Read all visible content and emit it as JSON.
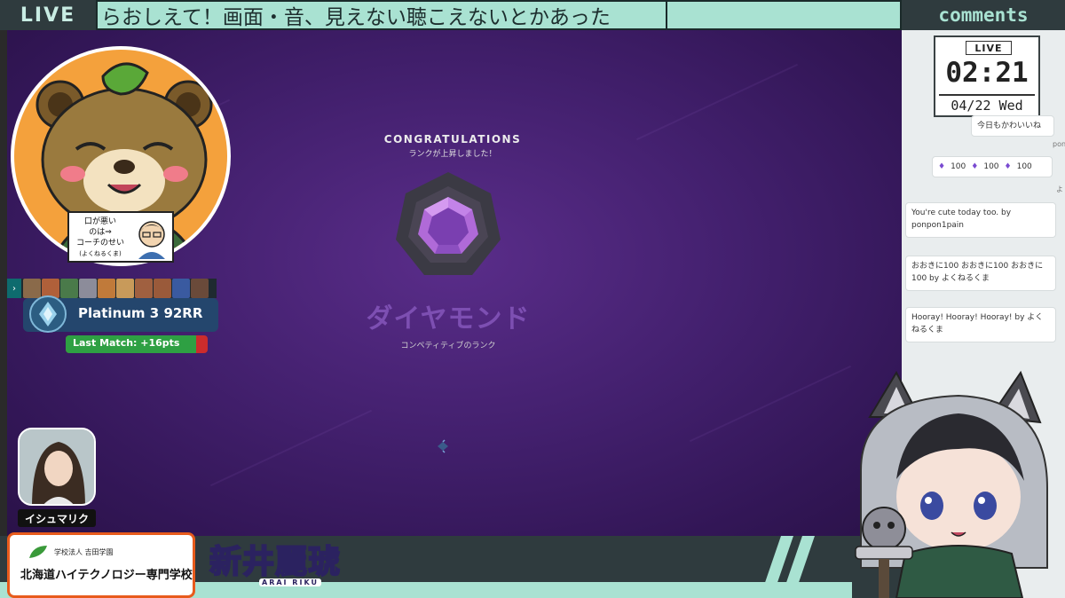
{
  "topbar": {
    "live_label": "LIVE",
    "ticker_text": "らおしえて！画面・音、見えない聴こえないとかあった",
    "comments_label": "comments"
  },
  "game": {
    "congrats_title": "CONGRATULATIONS",
    "congrats_sub": "ランクが上昇しました！",
    "rank_name": "ダイヤモンド",
    "rank_desc": "コンペティティブのランク",
    "rank_color": "#7d4fb2"
  },
  "overlay": {
    "sign_lines": [
      "口が悪い",
      "のは⇒",
      "コーチのせい",
      "(よくねるくま)"
    ],
    "rank_card_text": "Platinum 3  92RR",
    "last_match_text": "Last Match: +16pts",
    "last_match_progress": 0.92,
    "guest_name": "イシュマリク"
  },
  "bottom": {
    "school_small": "学校法人 吉田学園",
    "school_big": "北海道ハイテクノロジー専門学校",
    "brand_kanji": "新井麗琥",
    "brand_romaji": "ARAI RIKU"
  },
  "clock": {
    "live_label": "LIVE",
    "time": "02:21",
    "date": "04/22 Wed"
  },
  "comments": {
    "c1": "今日もかわいいね",
    "side1": "pon",
    "emote_count_1": "100",
    "emote_count_2": "100",
    "emote_count_3": "100",
    "side2": "よ",
    "c3": "You're cute today too. by ponpon1pain",
    "c4": "おおきに100 おおきに100 おおきに100 by よくねるくま",
    "c5": "Hooray! Hooray! Hooray! by よくねるくま"
  }
}
